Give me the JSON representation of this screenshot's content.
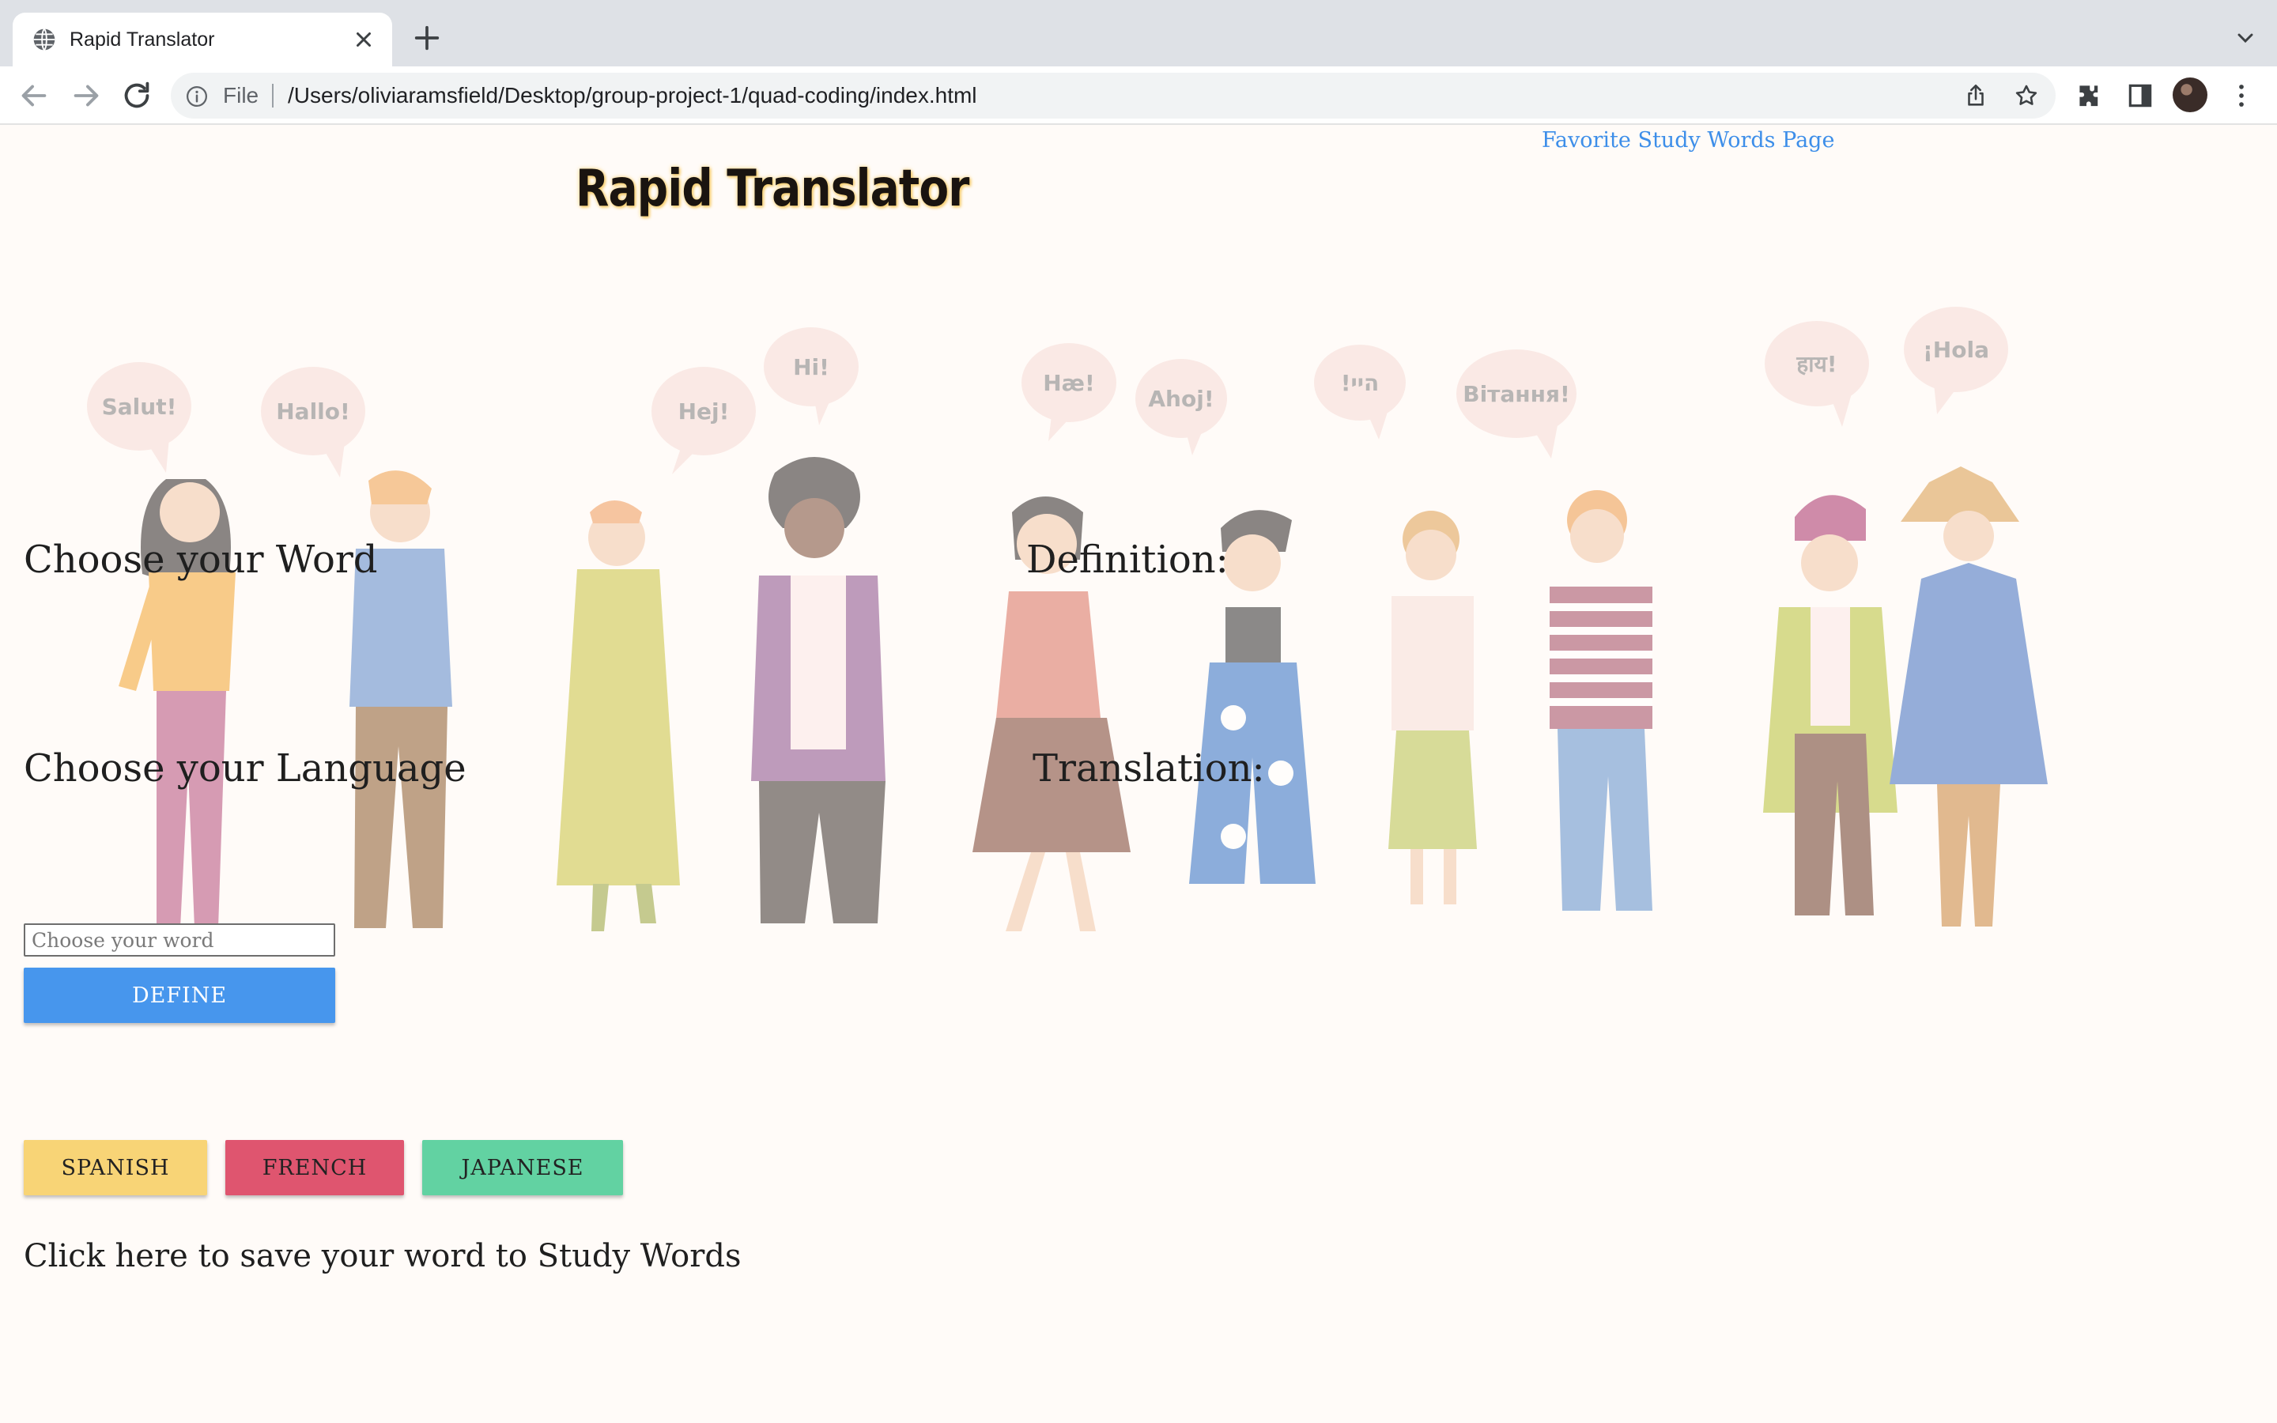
{
  "browser": {
    "tab_title": "Rapid Translator",
    "url_scheme_label": "File",
    "url": "/Users/oliviaramsfield/Desktop/group-project-1/quad-coding/index.html"
  },
  "header": {
    "favorites_link": "Favorite Study Words Page",
    "title": "Rapid Translator"
  },
  "hero": {
    "greetings": [
      "Salut!",
      "Hallo!",
      "Hej!",
      "Hi!",
      "Hæ!",
      "Ahoj!",
      "!היי",
      "Вітання!",
      "हाय!",
      "¡Hola"
    ]
  },
  "word_section": {
    "heading": "Choose your Word",
    "input_placeholder": "Choose your word",
    "input_value": "",
    "define_button": "DEFINE"
  },
  "definition": {
    "heading": "Definition:"
  },
  "language_section": {
    "heading": "Choose your Language",
    "buttons": [
      "SPANISH",
      "FRENCH",
      "JAPANESE"
    ]
  },
  "translation": {
    "heading": "Translation:"
  },
  "save_prompt": "Click here to save your word to Study Words",
  "colors": {
    "link": "#3d8ee9",
    "define": "#4796ed",
    "spanish": "#f8d476",
    "french": "#df556f",
    "japanese": "#62d2a2",
    "page_bg": "#fffbf8"
  }
}
